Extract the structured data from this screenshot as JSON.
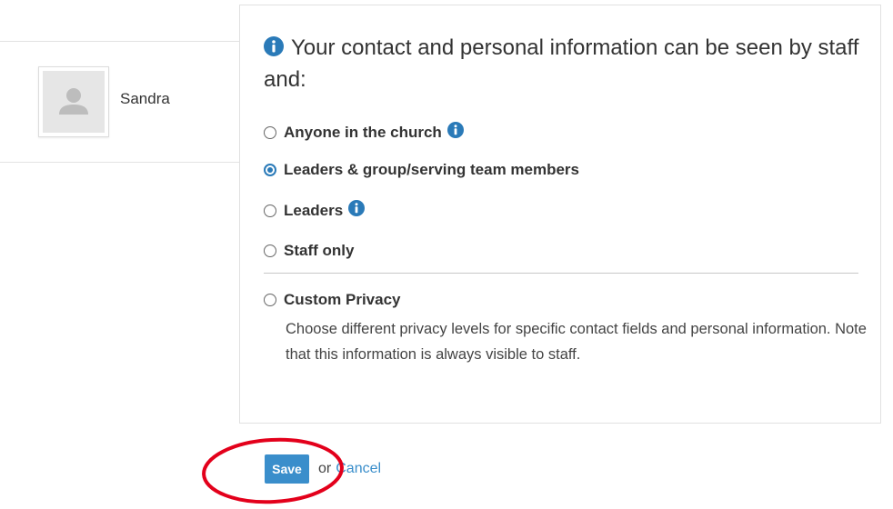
{
  "profile": {
    "name": "Sandra",
    "avatar_icon": "person-silhouette-icon"
  },
  "privacy": {
    "heading": "Your contact and personal information can be seen by staff and:",
    "heading_icon": "info-icon",
    "options": [
      {
        "label": "Anyone in the church",
        "checked": false,
        "has_info": true
      },
      {
        "label": "Leaders & group/serving team members",
        "checked": true,
        "has_info": false
      },
      {
        "label": "Leaders",
        "checked": false,
        "has_info": true
      },
      {
        "label": "Staff only",
        "checked": false,
        "has_info": false
      },
      {
        "label": "Custom Privacy",
        "checked": false,
        "has_info": false
      }
    ],
    "custom_description": "Choose different privacy levels for specific contact fields and personal information. Note that this information is always visible to staff."
  },
  "actions": {
    "save_label": "Save",
    "or_text": "or",
    "cancel_label": "Cancel"
  },
  "colors": {
    "accent": "#3a8ecb",
    "info_icon": "#2a7ab8",
    "annotation": "#e3001b"
  }
}
